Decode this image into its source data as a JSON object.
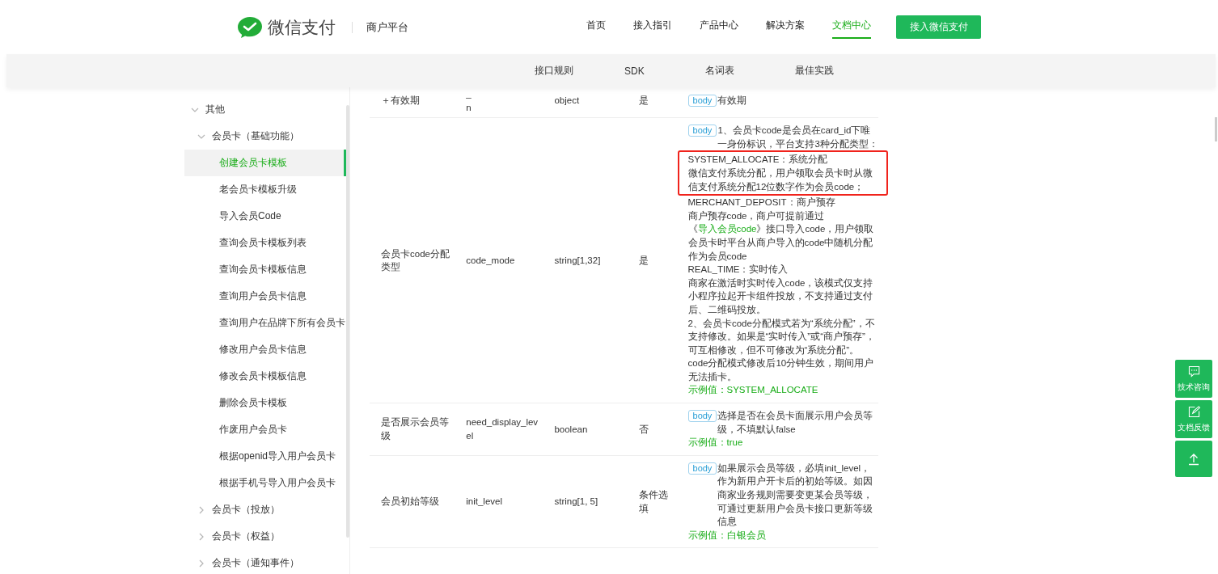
{
  "header": {
    "brand": "微信支付",
    "platform": "商户平台",
    "nav": [
      {
        "label": "首页",
        "selected": false
      },
      {
        "label": "接入指引",
        "selected": false
      },
      {
        "label": "产品中心",
        "selected": false
      },
      {
        "label": "解决方案",
        "selected": false
      },
      {
        "label": "文档中心",
        "selected": true
      }
    ],
    "cta": "接入微信支付"
  },
  "subnav": [
    "接口规则",
    "SDK",
    "名词表",
    "最佳实践"
  ],
  "sidebar": {
    "items": [
      {
        "label": "其他",
        "expanded": true,
        "selected": false,
        "children": [
          {
            "label": "会员卡（基础功能）",
            "expanded": true,
            "selected": false,
            "children": [
              {
                "label": "创建会员卡模板",
                "selected": true
              },
              {
                "label": "老会员卡模板升级",
                "selected": false
              },
              {
                "label": "导入会员Code",
                "selected": false
              },
              {
                "label": "查询会员卡模板列表",
                "selected": false
              },
              {
                "label": "查询会员卡模板信息",
                "selected": false
              },
              {
                "label": "查询用户会员卡信息",
                "selected": false
              },
              {
                "label": "查询用户在品牌下所有会员卡",
                "selected": false
              },
              {
                "label": "修改用户会员卡信息",
                "selected": false
              },
              {
                "label": "修改会员卡模板信息",
                "selected": false
              },
              {
                "label": "删除会员卡模板",
                "selected": false
              },
              {
                "label": "作废用户会员卡",
                "selected": false
              },
              {
                "label": "根据openid导入用户会员卡",
                "selected": false
              },
              {
                "label": "根据手机号导入用户会员卡",
                "selected": false
              }
            ]
          },
          {
            "label": "会员卡（投放）",
            "expanded": false,
            "selected": false
          },
          {
            "label": "会员卡（权益）",
            "expanded": false,
            "selected": false
          },
          {
            "label": "会员卡（通知事件）",
            "expanded": false,
            "selected": false
          }
        ]
      }
    ]
  },
  "table": {
    "rows": [
      {
        "name": "＋有效期",
        "field": [
          "_",
          "n"
        ],
        "type": "object",
        "required": "是",
        "description": {
          "tag": "body",
          "lead": "有效期"
        }
      },
      {
        "name": "会员卡code分配类型",
        "field": [
          "code_mode"
        ],
        "type": "string[1,32]",
        "required": "是",
        "description": {
          "tag": "body",
          "lead": "1、会员卡code是会员在card_id下唯一身份标识，平台支持3种分配类型：",
          "blocks": [
            {
              "kind": "highlight",
              "lines": [
                "SYSTEM_ALLOCATE：系统分配",
                "微信支付系统分配，用户领取会员卡时从微信支付系统分配12位数字作为会员code；"
              ]
            },
            {
              "kind": "text",
              "text": "MERCHANT_DEPOSIT：商户预存"
            },
            {
              "kind": "link",
              "before": "商户预存code，商户可提前通过《",
              "link": "导入会员code",
              "after": "》接口导入code，用户领取会员卡时平台从商户导入的code中随机分配作为会员code"
            },
            {
              "kind": "text",
              "text": "REAL_TIME：实时传入"
            },
            {
              "kind": "text",
              "text": "商家在激活时实时传入code，该模式仅支持小程序拉起开卡组件投放，不支持通过支付后、二维码投放。"
            },
            {
              "kind": "text",
              "text": "2、会员卡code分配模式若为“系统分配”，不支持修改。如果是“实时传入”或“商户预存”，可互相修改，但不可修改为“系统分配”。"
            },
            {
              "kind": "text",
              "text": "code分配模式修改后10分钟生效，期间用户无法插卡。"
            }
          ],
          "example": "示例值：SYSTEM_ALLOCATE"
        }
      },
      {
        "name": "是否展示会员等级",
        "field": [
          "need_display_level"
        ],
        "type": "boolean",
        "required": "否",
        "description": {
          "tag": "body",
          "lead": "选择是否在会员卡面展示用户会员等级，不填默认false",
          "example": "示例值：true"
        }
      },
      {
        "name": "会员初始等级",
        "field": [
          "init_level"
        ],
        "type": "string[1, 5]",
        "required": "条件选填",
        "description": {
          "tag": "body",
          "lead": "如果展示会员等级，必填init_level，作为新用户开卡后的初始等级。如因商家业务规则需要变更某会员等级，可通过更新用户会员卡接口更新等级信息",
          "example": "示例值：白银会员"
        }
      }
    ]
  },
  "float_buttons": [
    {
      "kind": "chat",
      "label": "技术咨询"
    },
    {
      "kind": "edit",
      "label": "文档反馈"
    },
    {
      "kind": "top"
    }
  ]
}
